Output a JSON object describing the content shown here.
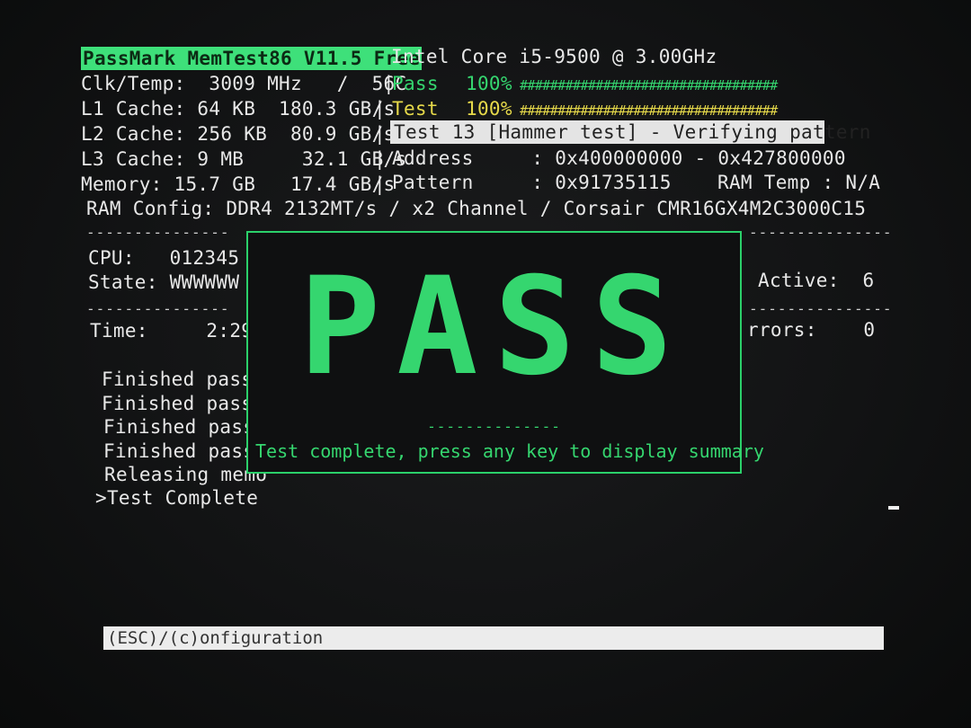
{
  "header": {
    "title": "PassMark MemTest86 V11.5 Free",
    "cpu_model": "Intel Core i5-9500 @ 3.00GHz"
  },
  "left_info": {
    "clk_temp": "Clk/Temp:  3009 MHz   /  56C",
    "l1": "L1 Cache: 64 KB  180.3 GB/s",
    "l2": "L2 Cache: 256 KB  80.9 GB/s",
    "l3": "L3 Cache: 9 MB     32.1 GB/s",
    "memory": "Memory: 15.7 GB   17.4 GB/s",
    "ram_config": "RAM Config: DDR4 2132MT/s / x2 Channel / Corsair CMR16GX4M2C3000C15"
  },
  "progress": {
    "pass_label": "Pass",
    "pass_pct": "100%",
    "pass_value": 1.0,
    "test_label": "Test",
    "test_pct": "100%",
    "test_value": 1.0,
    "bar": "##################################"
  },
  "test_info": {
    "current_test": "Test 13 [Hammer test] - Verifying pattern",
    "address": "Address     : 0x400000000 - 0x427800000",
    "pattern": "Pattern     : 0x91735115",
    "ram_temp": "RAM Temp : N/A"
  },
  "status": {
    "cpu": "CPU:   012345",
    "state": "State: WWWWWW",
    "time": "Time:     2:29:",
    "active": "Active:  6",
    "errors": "rrors:    0"
  },
  "log": [
    "Finished pass",
    "Finished pass",
    "Finished pass",
    "Finished pass",
    "Releasing memo",
    ">Test Complete"
  ],
  "popup": {
    "result": "PASS",
    "dashes": "--------------",
    "message": "Test complete, press any key to display summary"
  },
  "footer": {
    "hint": "(ESC)/(c)onfiguration"
  },
  "separator": "---------------",
  "colors": {
    "accent_green": "#35d66f",
    "progress_yellow": "#e6d94a",
    "background": "#121314"
  }
}
